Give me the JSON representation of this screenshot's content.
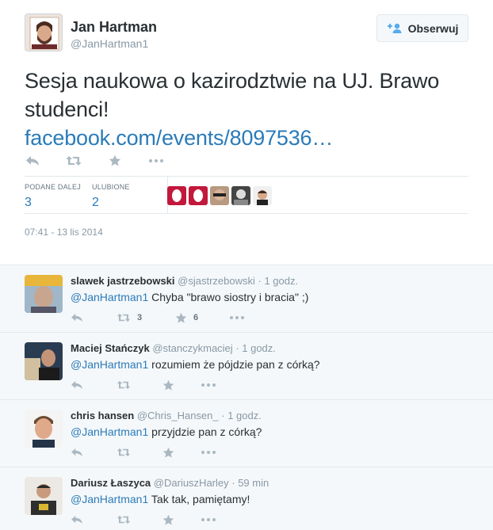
{
  "author": {
    "name": "Jan Hartman",
    "handle": "@JanHartman1",
    "avatar_icon": "user-avatar-icon"
  },
  "follow": {
    "label": "Obserwuj",
    "icon": "follow-user-plus-icon",
    "accent": "#55acee"
  },
  "tweet": {
    "text": "Sesja naukowa o kazirodztwie na UJ. Brawo studenci!",
    "link": "facebook.com/events/8097536…"
  },
  "stats": {
    "retweets_label": "PODANE DALEJ",
    "retweets": "3",
    "favorites_label": "ULUBIONE",
    "favorites": "2",
    "favoriters": [
      "favoriter-avatar",
      "favoriter-avatar",
      "favoriter-avatar",
      "favoriter-avatar",
      "favoriter-avatar"
    ]
  },
  "timestamp": "07:41 - 13 lis 2014",
  "colors": {
    "link": "#2b7bb9",
    "muted": "#8899a6",
    "reply_bg": "#f5f8fa"
  },
  "replies": [
    {
      "name": "slawek jastrzebowski",
      "handle": "@sjastrzebowski",
      "time": "· 1 godz.",
      "mention": "@JanHartman1",
      "text": " Chyba \"brawo siostry i bracia\" ;)",
      "retweets": "3",
      "favorites": "6"
    },
    {
      "name": "Maciej Stańczyk",
      "handle": "@stanczykmaciej",
      "time": "· 1 godz.",
      "mention": "@JanHartman1",
      "text": " rozumiem że pójdzie pan z córką?",
      "retweets": "",
      "favorites": ""
    },
    {
      "name": "chris hansen",
      "handle": "@Chris_Hansen_",
      "time": "· 1 godz.",
      "mention": "@JanHartman1",
      "text": " przyjdzie pan z córką?",
      "retweets": "",
      "favorites": ""
    },
    {
      "name": "Dariusz Łaszyca",
      "handle": "@DariuszHarley",
      "time": "· 59 min",
      "mention": "@JanHartman1",
      "text": " Tak tak, pamiętamy!",
      "retweets": "",
      "favorites": ""
    }
  ]
}
